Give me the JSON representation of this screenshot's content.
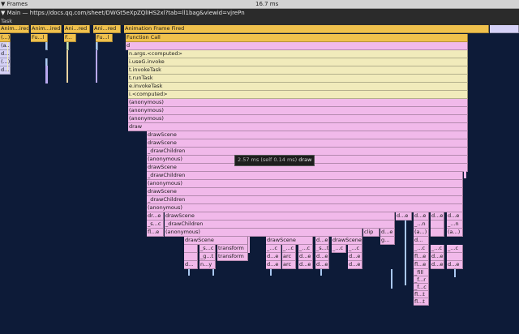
{
  "frames": {
    "toggle": "▼ Frames",
    "duration": "16.7 ms"
  },
  "main": {
    "label": "▼ Main — https://docs.qq.com/sheet/DWGt5eXpZQlIHS2xl?tab=ll1bag&viewid=vjrePn"
  },
  "task": {
    "label": "Task"
  },
  "tooltip": {
    "time": "2.57 ms (self 0.14 ms)",
    "name": "draw"
  },
  "colors": {
    "yellow": "#f0c14d",
    "pale_yellow": "#f1ebbb",
    "pink": "#f1b9ea",
    "background": "#0d1b38"
  },
  "bars": {
    "anim1": "Anim...ired",
    "anim2": "Anim...ired",
    "anim3": "Ani...red",
    "anim4": "Ani...red",
    "animMain": "Animation Frame Fired",
    "fu1": "(...)",
    "fu2": "Fu...l",
    "fu3": "F...",
    "fu4": "Fu...l",
    "funcCall": "Function Call",
    "a1": "(a...)",
    "a2": "d...",
    "a3": "(...)",
    "a4": "d...",
    "d": "d",
    "nargs": "n.args.<computed>",
    "iuseg": "i.useG.invoke",
    "tinvoke": "t.invokeTask",
    "trun": "t.runTask",
    "einvoke": "e.invokeTask",
    "icomputed": "i.<computed>",
    "anon1": "(anonymous)",
    "anon2": "(anonymous)",
    "anon3": "(anonymous)",
    "draw": "draw",
    "drawScene1": "drawScene",
    "drawScene2": "drawScene",
    "drawChildren1": "_drawChildren",
    "anon4": "(anonymous)",
    "drawScene3": "drawScene",
    "drawChildren2": "_drawChildren",
    "anon5": "(anonymous)",
    "drawScene4": "drawScene",
    "drawChildren3": "_drawChildren",
    "anon6": "(anonymous)",
    "dre": "dr...e",
    "drawScene5": "drawScene",
    "de_r1": "d...e",
    "de_r2": "d...e",
    "de_r3": "d...e",
    "de_r4": "d...e",
    "sc": "_s...c",
    "drawChildren4": "_drawChildren",
    "n1": "_...n",
    "n2": "_...n",
    "fle": "fl...e",
    "anon7": "(anonymous)",
    "clip1": "clip",
    "clip2": "clip",
    "de5": "d...e",
    "a5": "(a...)",
    "a6": "(a...)",
    "drawScene6": "drawScene",
    "drawScene7": "drawScene",
    "de6": "d...e",
    "drawScene8": "drawScene",
    "g1": "g...",
    "sc2": "_s...c",
    "transform1": "transform",
    "c1": "_...c",
    "c2": "_...c",
    "s1": "_s...t",
    "c3": "_...c",
    "c4": "_...c",
    "c5": "_...c",
    "c6": "_...c",
    "c7": "_...c",
    "c8": "_...c",
    "dg": "_g...t",
    "transform2": "transform",
    "de7": "d...e",
    "arc1": "arc",
    "de8": "d...e",
    "de9": "d...e",
    "de10": "d...e",
    "fle2": "fl...e",
    "de11": "d...e",
    "dd": "d...",
    "ny": "n...y",
    "de12": "d...e",
    "arc2": "arc",
    "de13": "d...e",
    "de14": "d...e",
    "de15": "d...e",
    "fle3": "fl...e",
    "de16": "d...e",
    "de17": "d...e",
    "fill": "_fill",
    "fr": "_f...r",
    "fc": "_f...c",
    "flt1": "fl...t",
    "flt2": "fl...t"
  }
}
